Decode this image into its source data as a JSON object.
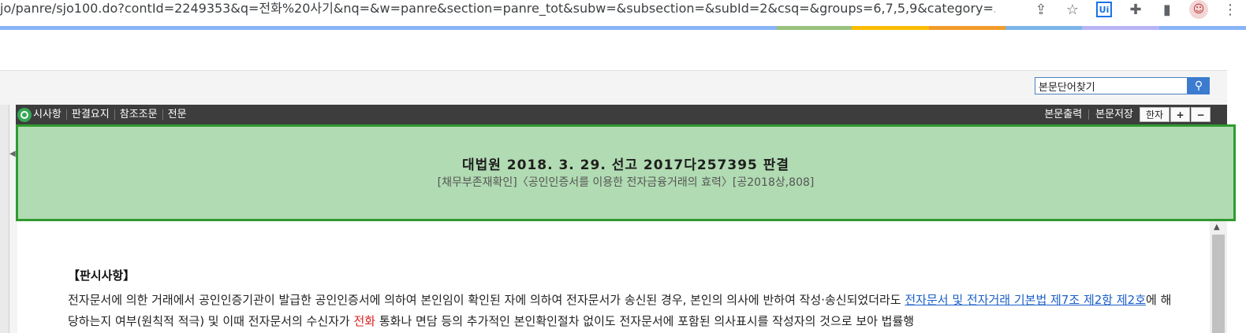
{
  "browser": {
    "url": "jo/panre/sjo100.do?contId=2249353&q=전화%20사기&nq=&w=panre&section=panre_tot&subw=&subsection=&subId=2&csq=&groups=6,7,5,9&category=...",
    "icons": [
      "share-icon",
      "star-icon",
      "uipath-extension-icon",
      "puzzle-extensions-icon",
      "side-panel-icon",
      "profile-avatar-icon",
      "more-menu-icon"
    ],
    "ui_label": "Ui"
  },
  "colors": {
    "strip": [
      "#8ab4f8",
      "#98c27e",
      "#fbbc04",
      "#f29b2a",
      "#7cb5e8",
      "#b9b5f5",
      "#8ab4f8"
    ],
    "header_green": "#b1dbb2",
    "header_border": "#2f9a2f",
    "toolbar": "#3d3d3d",
    "link": "#1a5fc8",
    "highlight": "#e02020"
  },
  "search": {
    "value": "본문단어찾기"
  },
  "toolbar": {
    "tabs": [
      "판시사항",
      "판결요지",
      "참조조문",
      "전문"
    ],
    "tab_first_visible": "시사항",
    "print": "본문출력",
    "save": "본문저장",
    "hanja": "한자",
    "zoom_in": "+",
    "zoom_out": "−"
  },
  "case": {
    "title": "대법원  2018. 3. 29.  선고  2017다257395  판결",
    "subtitle": "[채무부존재확인]〈공인인증서를 이용한 전자금융거래의 효력〉[공2018상,808]"
  },
  "body": {
    "section_heading": "【판시사항】",
    "text_1": "전자문서에 의한 거래에서 공인인증기관이 발급한 공인인증서에 의하여 본인임이 확인된 자에 의하여 전자문서가 송신된 경우, 본인의 의사에 반하여 작성·송신되었더라도 ",
    "link_1": "전자문서 및 전자거래 기본법 제7조 제2항 제2호",
    "text_2": "에 해당하는지 여부(원칙적 적극) 및 이때 전자문서의 수신자가 ",
    "highlight": "전화",
    "text_3": " 통화나 면담 등의 추가적인 본인확인절차 없이도 전자문서에 포함된 의사표시를 작성자의 것으로 보아 법률행"
  }
}
